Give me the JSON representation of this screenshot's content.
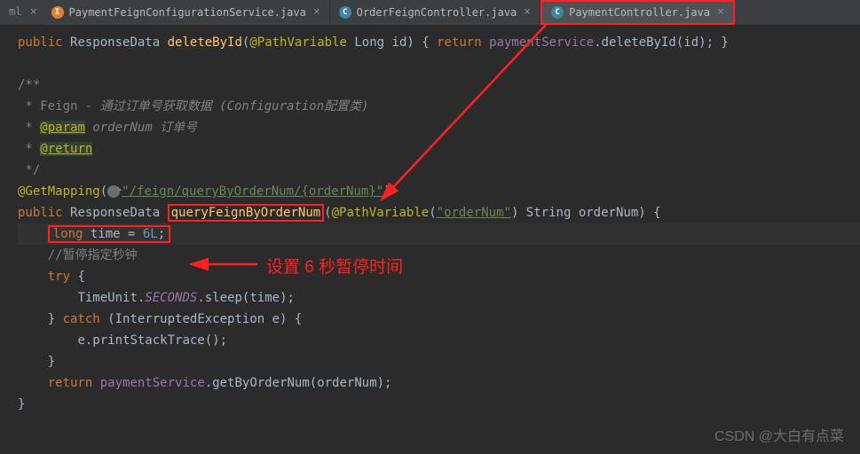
{
  "tabs": {
    "ml": "ml",
    "t1": "PaymentFeignConfigurationService.java",
    "t2": "OrderFeignController.java",
    "t3": "PaymentController.java",
    "close": "×"
  },
  "code": {
    "l1_public": "public",
    "l1_type": "ResponseData",
    "l1_method": "deleteById",
    "l1_anno": "@PathVariable",
    "l1_ptype": "Long",
    "l1_pname": "id",
    "l1_return": "return",
    "l1_field": "paymentService",
    "l1_call": ".deleteById(",
    "l1_arg": "id",
    "l1_end": "); }",
    "c1": "/**",
    "c2_a": " * Feign - ",
    "c2_b": "通过订单号获取数据 (Configuration配置类)",
    "c3_a": " * ",
    "c3_param": "@param",
    "c3_b": " orderNum ",
    "c3_c": "订单号",
    "c4_a": " * ",
    "c4_return": "@return",
    "c5": " */",
    "gm": "@GetMapping",
    "gm_url": "\"/feign/queryByOrderNum/{orderNum}\"",
    "sig_public": "public",
    "sig_type": "ResponseData",
    "sig_method": "queryFeignByOrderNum",
    "sig_anno": "@PathVariable",
    "sig_annoval": "\"orderNum\"",
    "sig_ptype": "String",
    "sig_pname": "orderNum",
    "time_kw": "long",
    "time_var": " time = ",
    "time_val": "6L",
    "time_semi": ";",
    "pause_comment": "//暂停指定秒钟",
    "try": "try",
    "tu": "TimeUnit",
    "seconds": "SECONDS",
    "sleep": ".sleep(",
    "sleep_arg": "time",
    "sleep_end": ");",
    "catch": "catch",
    "catch_type": "(InterruptedException e) {",
    "pst": "e.printStackTrace();",
    "brace": "}",
    "ret": "return",
    "ret_field": "paymentService",
    "ret_call": ".getByOrderNum(",
    "ret_arg": "orderNum",
    "ret_end": ");"
  },
  "annotation": "设置 6 秒暂停时间",
  "watermark": "CSDN @大白有点菜"
}
